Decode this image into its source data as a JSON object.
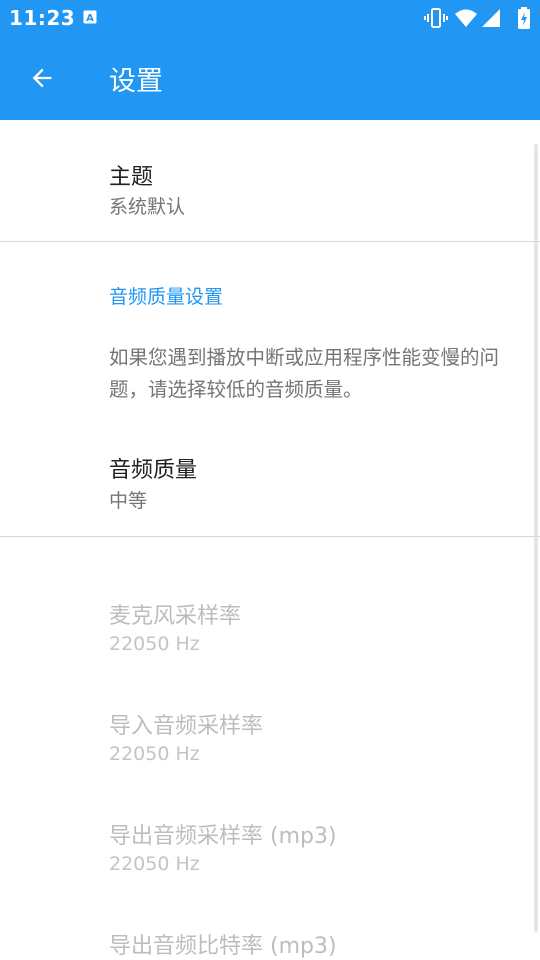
{
  "status_bar": {
    "time": "11:23",
    "notification_icon": "font-a-icon",
    "icons": [
      "vibrate-icon",
      "wifi-icon",
      "cell-signal-icon",
      "battery-charging-icon"
    ]
  },
  "app_bar": {
    "back_icon": "arrow-left-icon",
    "title": "设置"
  },
  "theme_pref": {
    "title": "主题",
    "summary": "系统默认"
  },
  "audio_category": {
    "title": "音频质量设置",
    "info": "如果您遇到播放中断或应用程序性能变慢的问题，请选择较低的音频质量。"
  },
  "quality_pref": {
    "title": "音频质量",
    "summary": "中等"
  },
  "disabled_prefs": [
    {
      "title": "麦克风采样率",
      "summary": "22050 Hz"
    },
    {
      "title": "导入音频采样率",
      "summary": "22050 Hz"
    },
    {
      "title": "导出音频采样率 (mp3)",
      "summary": "22050 Hz"
    },
    {
      "title": "导出音频比特率 (mp3)",
      "summary": ""
    }
  ],
  "colors": {
    "primary": "#2196F3",
    "accent_text": "#2196F3",
    "disabled_text": "#bdbdbd"
  }
}
